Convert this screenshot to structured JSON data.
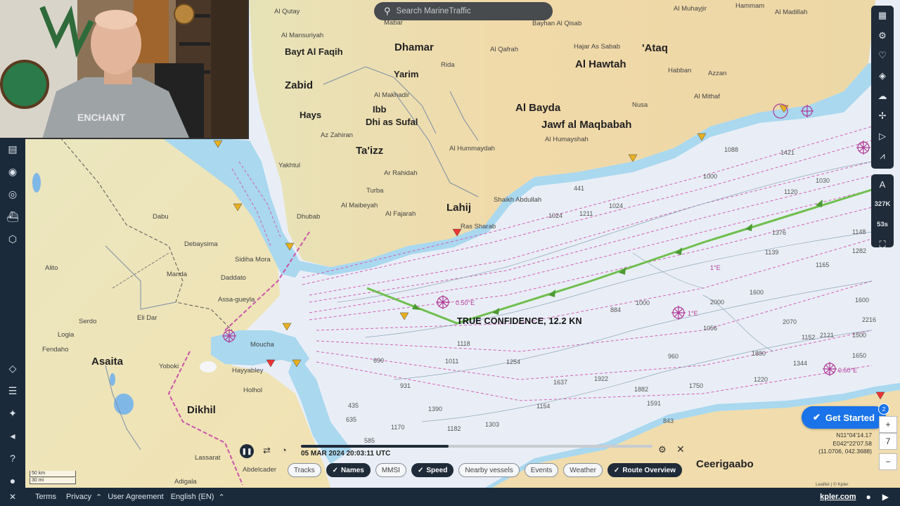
{
  "search": {
    "placeholder": "Search MarineTraffic",
    "icon": "search-icon"
  },
  "places": {
    "dhamar": "Dhamar",
    "ataq": "'Ataq",
    "al_hawtah": "Al Hawtah",
    "zabid": "Zabid",
    "ibb": "Ibb",
    "yarim": "Yarim",
    "dhi_as_sufal": "Dhi as Sufal",
    "al_bayda": "Al Bayda",
    "jawf": "Jawf al Maqbabah",
    "taizz": "Ta'izz",
    "lahij": "Lahij",
    "asaita": "Asaita",
    "dikhil": "Dikhil",
    "ceerigaabo": "Ceerigaabo",
    "bayt_al_faqih": "Bayt Al Faqih",
    "hays": "Hays",
    "al_qutay": "Al Qutay",
    "al_mansuriyah": "Al Mansuriyah",
    "mabar": "Mabar",
    "bayhan": "Bayhan Al Qisab",
    "al_muhayjir": "Al Muhayjir",
    "hammam": "Hammam",
    "al_madillah": "Al Madillah",
    "al_qafrah": "Al Qafrah",
    "rida": "Rida",
    "hajar_as_sabab": "Hajar As Sabab",
    "habban": "Habban",
    "azzan": "Azzan",
    "al_makhadir": "Al Makhadir",
    "al_mithaf": "Al Mithaf",
    "nusa": "Nusa",
    "az_zahiran": "Az Zahiran",
    "al_hummaydah": "Al Hummaydah",
    "al_humayshah": "Al Humayshah",
    "ar_rahidah": "Ar Rahidah",
    "turba": "Turba",
    "al_maibeyah": "Al Maibeyah",
    "al_fajarah": "Al Fajarah",
    "dabu": "Dabu",
    "debaysima": "Debaysima",
    "alito": "Alito",
    "manda": "Manda",
    "daddato": "Daddato",
    "sidiha_mora": "Sidiha Mora",
    "assa_gueyla": "Assa-gueyla",
    "eli_dar": "Eli Dar",
    "serdo": "Serdo",
    "logia": "Logia",
    "fendaho": "Fendaho",
    "yoboki": "Yoboki",
    "holhol": "Holhol",
    "hayyabley": "Hayyabley",
    "moucha": "Moucha",
    "lassarat": "Lassarat",
    "abdelcader": "Abdelcader",
    "adigala": "Adigala",
    "yakhtul": "Yakhtul",
    "dhubab": "Dhubab",
    "shaikh_abdullah": "Shaikh Abdullah",
    "ras_sharab": "Ras Sharab"
  },
  "vessel": {
    "name": "TRUE CONFIDENCE",
    "speed": "12.2 KN",
    "label": "TRUE CONFIDENCE, 12.2 KN"
  },
  "chart_marks": {
    "deg_a": "0.50°E",
    "deg_b": "1°E",
    "deg_c": "0.50°E",
    "deg_d": "1°E"
  },
  "depths": [
    "441",
    "1024",
    "1211",
    "1024",
    "1088",
    "1421",
    "1000",
    "1139",
    "884",
    "1056",
    "1118",
    "1011",
    "690",
    "931",
    "1254",
    "1637",
    "1922",
    "1882",
    "1591",
    "1344",
    "1220",
    "2000",
    "1750",
    "1650",
    "1500",
    "1282",
    "1165",
    "1376",
    "1120",
    "1000",
    "960",
    "843",
    "435",
    "1170",
    "1390",
    "1303",
    "1182",
    "1154",
    "1600",
    "1152",
    "2070",
    "2121",
    "1880",
    "2216",
    "1600",
    "1148",
    "1030",
    "635",
    "585"
  ],
  "right_tools": {
    "a_label": "A",
    "zoom_level": "327K",
    "time_step": "53s"
  },
  "get_started": {
    "label": "Get Started",
    "badge": "2"
  },
  "small_zoom": {
    "plus": "+",
    "seven": "7",
    "minus": "−"
  },
  "coords": {
    "lat": "N11°04'14.17",
    "lon": "E042°22'07.58",
    "dec": "(11.0706, 042.3688)"
  },
  "playback": {
    "time": "05 MAR 2024 20:03:11 UTC",
    "progress": 0.42
  },
  "chips": [
    {
      "label": "Tracks",
      "on": false
    },
    {
      "label": "Names",
      "on": true
    },
    {
      "label": "MMSI",
      "on": false
    },
    {
      "label": "Speed",
      "on": true
    },
    {
      "label": "Nearby vessels",
      "on": false
    },
    {
      "label": "Events",
      "on": false
    },
    {
      "label": "Weather",
      "on": false
    },
    {
      "label": "Route Overview",
      "on": true
    }
  ],
  "footer": {
    "terms": "Terms",
    "privacy": "Privacy",
    "user_agreement": "User Agreement",
    "language": "English (EN)",
    "brand": "kpler.com"
  },
  "scale": {
    "top": "50 km",
    "bottom": "30 mi"
  },
  "attribution": "Leaflet | © Kpler"
}
